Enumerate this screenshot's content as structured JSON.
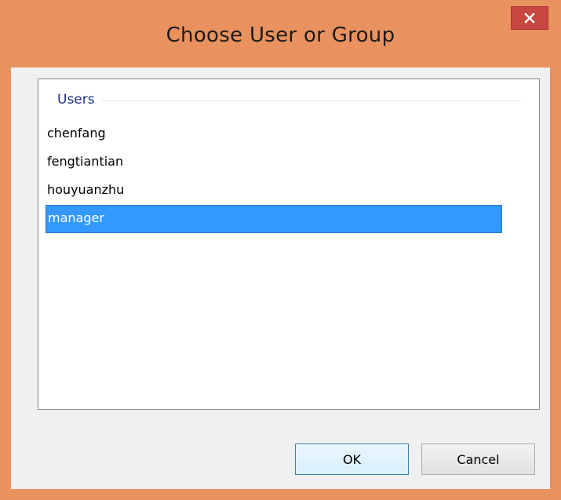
{
  "window": {
    "title": "Choose User or Group",
    "frame_color": "#e9925f",
    "close_icon": "close-icon"
  },
  "group": {
    "title": "Users"
  },
  "users": [
    {
      "name": "chenfang",
      "selected": false
    },
    {
      "name": "fengtiantian",
      "selected": false
    },
    {
      "name": "houyuanzhu",
      "selected": false
    },
    {
      "name": "manager",
      "selected": true
    }
  ],
  "buttons": {
    "ok_label": "OK",
    "cancel_label": "Cancel"
  },
  "colors": {
    "selection": "#3399ff",
    "group_title": "#1e3287",
    "close_button": "#c7463f"
  }
}
